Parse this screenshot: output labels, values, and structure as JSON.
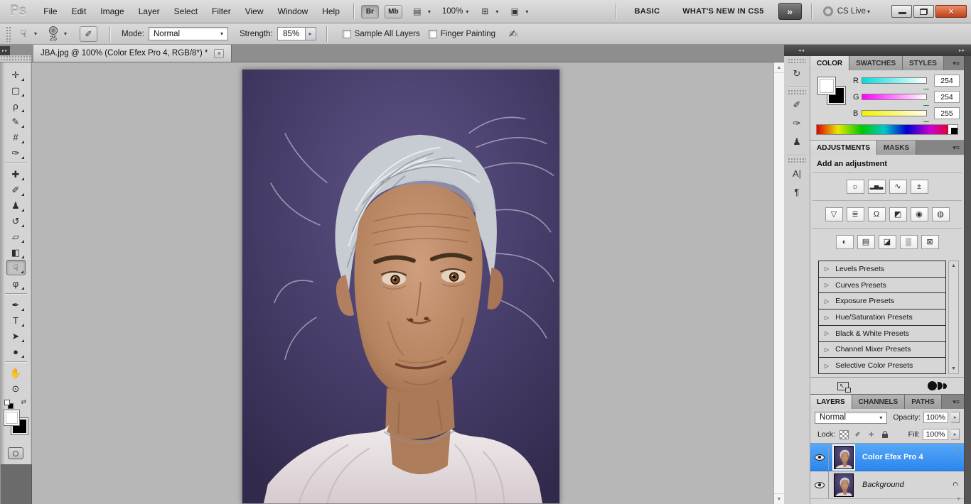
{
  "menu_bar": {
    "logo": "Ps",
    "menus": [
      "File",
      "Edit",
      "Image",
      "Layer",
      "Select",
      "Filter",
      "View",
      "Window",
      "Help"
    ],
    "bridge_label": "Br",
    "mini_bridge_label": "Mb",
    "view_extras_glyph": "▤",
    "zoom_level": "100%",
    "arrange_documents_glyph": "⊞",
    "screen_mode_glyph": "▣",
    "dropdown_glyph": "▾",
    "workspace_label": "BASIC",
    "whats_new_label": "WHAT'S NEW IN CS5",
    "overflow_glyph": "»",
    "cs_live_label": "CS Live",
    "window_controls": {
      "close_glyph": "✕"
    }
  },
  "options_bar": {
    "tool_preset_glyph": "☟",
    "brush_size": "25",
    "panel_toggle_glyph": "✐",
    "mode_label": "Mode:",
    "mode_value": "Normal",
    "strength_label": "Strength:",
    "strength_value": "85%",
    "spinner_glyph": "▸",
    "dropdown_glyph": "▾",
    "sample_all_layers_label": "Sample All Layers",
    "finger_painting_label": "Finger Painting",
    "airbrush_glyph": "✍"
  },
  "document_tab": {
    "title": "JBA.jpg @ 100% (Color Efex Pro 4, RGB/8*) *",
    "close_glyph": "✕"
  },
  "tools": [
    {
      "name": "move",
      "glyph": "✛"
    },
    {
      "name": "rectangular-marquee",
      "glyph": "▢"
    },
    {
      "name": "lasso",
      "glyph": "ρ"
    },
    {
      "name": "quick-selection",
      "glyph": "✎"
    },
    {
      "name": "crop",
      "glyph": "#"
    },
    {
      "name": "eyedropper",
      "glyph": "✑"
    },
    {
      "name": "spot-healing-brush",
      "glyph": "✚"
    },
    {
      "name": "brush",
      "glyph": "✐"
    },
    {
      "name": "clone-stamp",
      "glyph": "♟"
    },
    {
      "name": "history-brush",
      "glyph": "↺"
    },
    {
      "name": "eraser",
      "glyph": "▱"
    },
    {
      "name": "paint-bucket",
      "glyph": "◧"
    },
    {
      "name": "smudge",
      "glyph": "☟"
    },
    {
      "name": "dodge",
      "glyph": "φ"
    },
    {
      "name": "pen",
      "glyph": "✒"
    },
    {
      "name": "type",
      "glyph": "T"
    },
    {
      "name": "path-selection",
      "glyph": "➤"
    },
    {
      "name": "ellipse-shape",
      "glyph": "●"
    },
    {
      "name": "hand",
      "glyph": "✋"
    },
    {
      "name": "zoom",
      "glyph": "⊙"
    }
  ],
  "toolbar_extras": {
    "swap_glyph": "⇄"
  },
  "canvas": {
    "scroll_up_glyph": "▲",
    "scroll_down_glyph": "▼"
  },
  "dock_header": {
    "collapse_left_glyph": "◂◂",
    "collapse_right_glyph": "▸▸"
  },
  "tools_dock_header": {
    "collapse_glyph": "▸▸"
  },
  "panel_column": {
    "icons": [
      {
        "name": "history",
        "glyph": "↻"
      },
      {
        "name": "brush-panel",
        "glyph": "✐"
      },
      {
        "name": "brush-presets",
        "glyph": "✑"
      },
      {
        "name": "clone-source",
        "glyph": "♟"
      },
      {
        "name": "character",
        "glyph": "A|"
      },
      {
        "name": "paragraph",
        "glyph": "¶"
      }
    ]
  },
  "color_panel": {
    "tabs": [
      "COLOR",
      "SWATCHES",
      "STYLES"
    ],
    "menu_glyph": "▾≡",
    "channels": [
      {
        "label": "R",
        "value": "254"
      },
      {
        "label": "G",
        "value": "254"
      },
      {
        "label": "B",
        "value": "255"
      }
    ]
  },
  "adjustments_panel": {
    "tabs": [
      "ADJUSTMENTS",
      "MASKS"
    ],
    "menu_glyph": "▾≡",
    "heading": "Add an adjustment",
    "icons_row1": [
      {
        "name": "brightness-contrast",
        "glyph": "☼"
      },
      {
        "name": "levels",
        "glyph": "▂▅▃"
      },
      {
        "name": "curves",
        "glyph": "∿"
      },
      {
        "name": "exposure",
        "glyph": "±"
      }
    ],
    "icons_row2": [
      {
        "name": "vibrance",
        "glyph": "▽"
      },
      {
        "name": "hue-saturation",
        "glyph": "≣"
      },
      {
        "name": "color-balance",
        "glyph": "Ω"
      },
      {
        "name": "black-and-white",
        "glyph": "◩"
      },
      {
        "name": "photo-filter",
        "glyph": "◉"
      },
      {
        "name": "channel-mixer",
        "glyph": "◍"
      }
    ],
    "icons_row3": [
      {
        "name": "invert",
        "glyph": "◐"
      },
      {
        "name": "posterize",
        "glyph": "▤"
      },
      {
        "name": "threshold",
        "glyph": "◪"
      },
      {
        "name": "gradient-map",
        "glyph": "▒"
      },
      {
        "name": "selective-color",
        "glyph": "⊠"
      }
    ],
    "preset_tri_glyph": "▷",
    "presets": [
      "Levels Presets",
      "Curves Presets",
      "Exposure Presets",
      "Hue/Saturation Presets",
      "Black & White Presets",
      "Channel Mixer Presets",
      "Selective Color Presets"
    ],
    "scroll_up_glyph": "▲",
    "scroll_down_glyph": "▼",
    "expand_glyph": "↖"
  },
  "layers_panel": {
    "tabs": [
      "LAYERS",
      "CHANNELS",
      "PATHS"
    ],
    "menu_glyph": "▾≡",
    "blend_mode": "Normal",
    "dropdown_glyph": "▾",
    "opacity_label": "Opacity:",
    "opacity_value": "100%",
    "spinner_glyph": "▸",
    "lock_label": "Lock:",
    "lock_paint_glyph": "✐",
    "lock_move_glyph": "✛",
    "fill_label": "Fill:",
    "fill_value": "100%",
    "layers": [
      {
        "name": "Color Efex Pro 4"
      },
      {
        "name": "Background"
      }
    ],
    "scroll_up_glyph": "▲",
    "scroll_down_glyph": "▼"
  },
  "colors": {
    "selection_blue": "#2f8ef5",
    "canvas_background": "#b7b7b7",
    "close_button_red": "#bf401c",
    "panel_background": "#d6d6d6"
  }
}
